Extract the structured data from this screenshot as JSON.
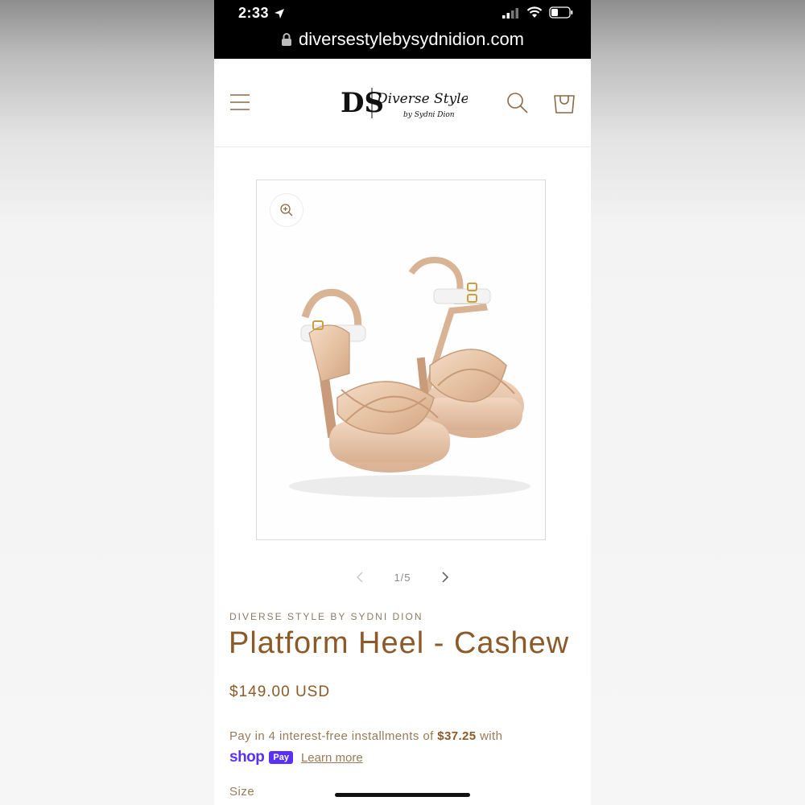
{
  "status_bar": {
    "time": "2:33",
    "url": "diversestylebysydnidion.com"
  },
  "header": {
    "logo_mark": "DS",
    "logo_line1": "Diverse Style",
    "logo_line2": "by Sydni Dion",
    "icons": [
      "menu-icon",
      "search-icon",
      "cart-icon"
    ]
  },
  "gallery": {
    "counter": "1/5"
  },
  "product": {
    "vendor": "DIVERSE STYLE BY SYDNI DION",
    "title": "Platform Heel - Cashew",
    "price": "$149.00 USD",
    "installments_prefix": "Pay in 4 interest-free installments of ",
    "installment_amount": "$37.25",
    "installments_suffix": " with",
    "shop_pay_word": "shop",
    "shop_pay_badge": "Pay",
    "learn_more": "Learn more",
    "size_label": "Size"
  },
  "colors": {
    "accent": "#8c5a28",
    "shop_pay": "#5a31f4"
  }
}
